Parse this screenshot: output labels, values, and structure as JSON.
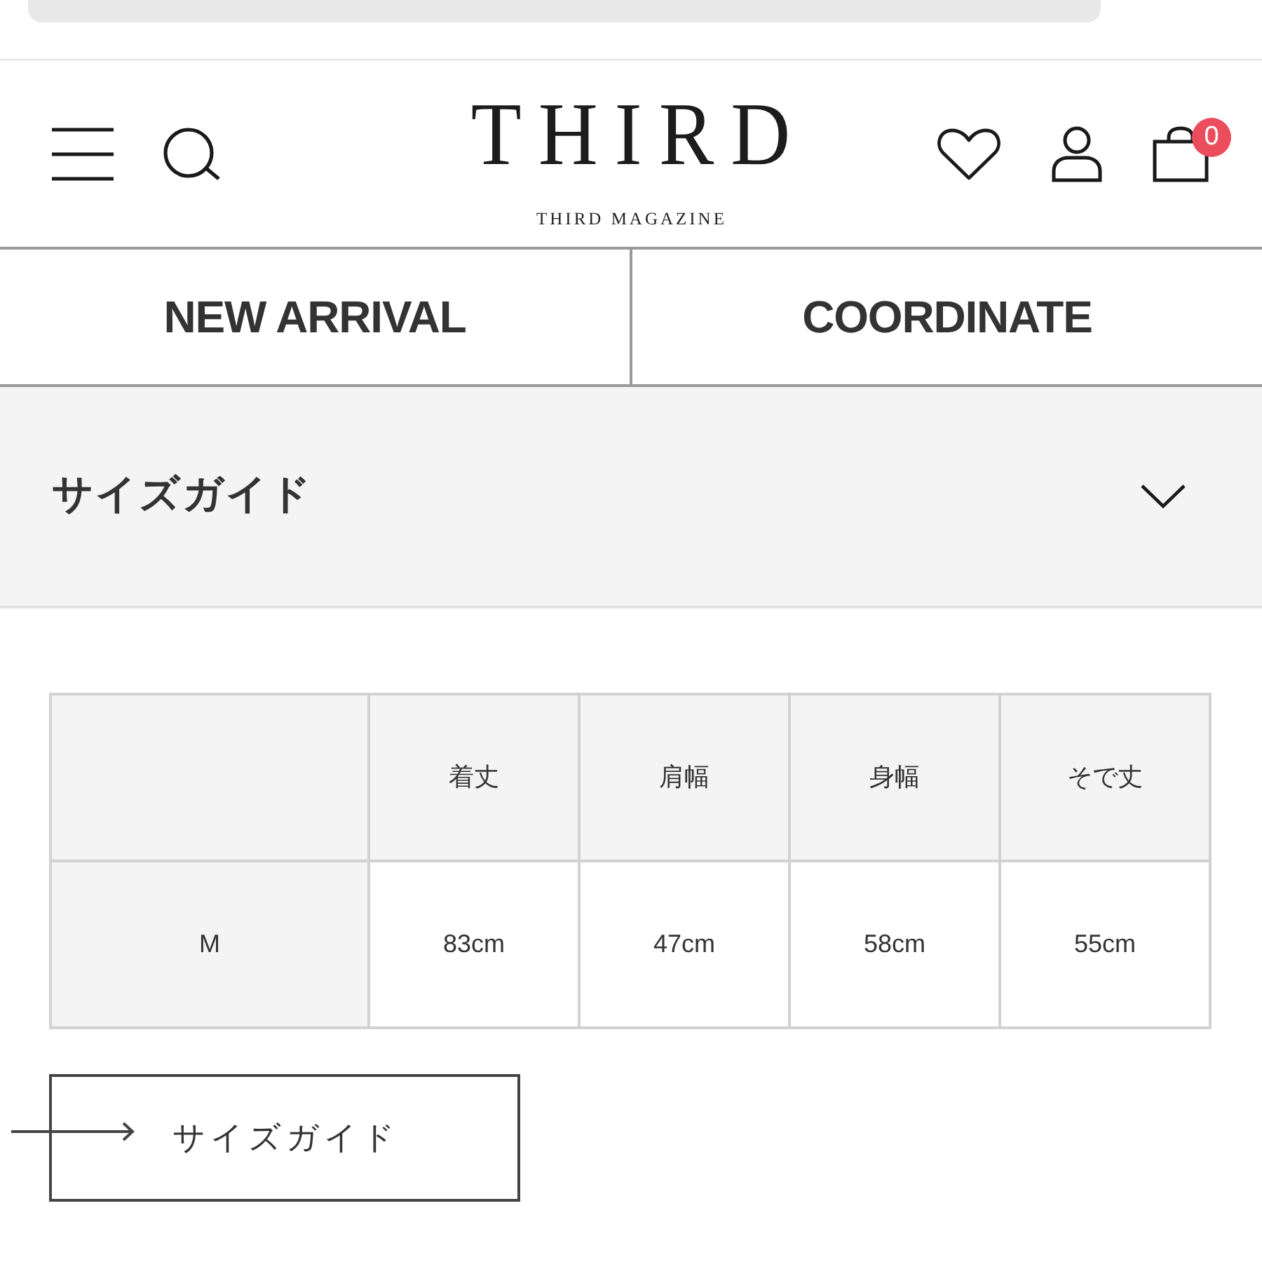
{
  "header": {
    "logo": "THIRD",
    "tagline": "THIRD MAGAZINE",
    "cart_count": "0"
  },
  "nav_links": [
    {
      "label": "NEW ARRIVAL"
    },
    {
      "label": "COORDINATE"
    }
  ],
  "accordion": {
    "title": "サイズガイド"
  },
  "size_table": {
    "columns": [
      "着丈",
      "肩幅",
      "身幅",
      "そで丈"
    ],
    "rows": [
      {
        "size": "M",
        "values": [
          "83cm",
          "47cm",
          "58cm",
          "55cm"
        ]
      }
    ]
  },
  "size_guide_link": {
    "label": "サイズガイド"
  }
}
